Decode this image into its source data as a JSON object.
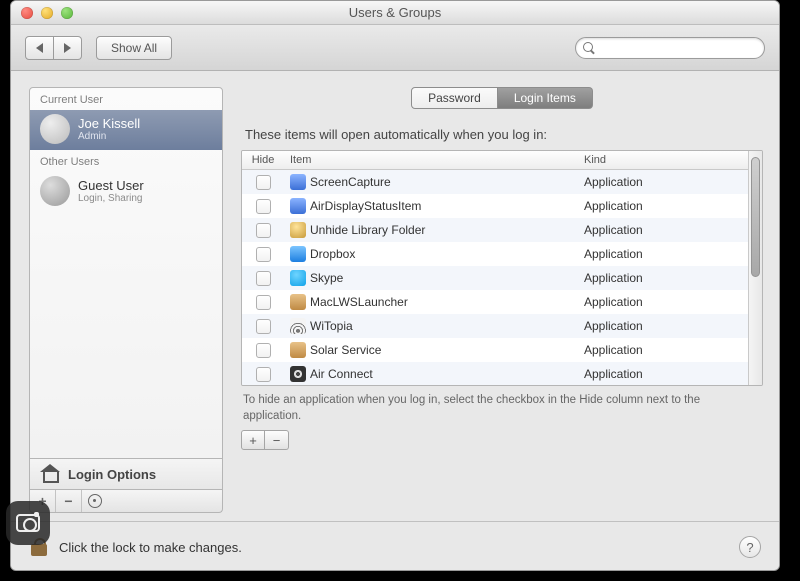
{
  "window": {
    "title": "Users & Groups"
  },
  "toolbar": {
    "show_all": "Show All",
    "search_placeholder": ""
  },
  "sidebar": {
    "current_header": "Current User",
    "other_header": "Other Users",
    "current": {
      "name": "Joe Kissell",
      "role": "Admin"
    },
    "others": [
      {
        "name": "Guest User",
        "role": "Login, Sharing"
      }
    ],
    "login_options": "Login Options"
  },
  "tabs": {
    "password": "Password",
    "login_items": "Login Items"
  },
  "main": {
    "intro": "These items will open automatically when you log in:",
    "columns": {
      "hide": "Hide",
      "item": "Item",
      "kind": "Kind"
    },
    "items": [
      {
        "name": "ScreenCapture",
        "kind": "Application",
        "icon": "ic-blue"
      },
      {
        "name": "AirDisplayStatusItem",
        "kind": "Application",
        "icon": "ic-blue"
      },
      {
        "name": "Unhide Library Folder",
        "kind": "Application",
        "icon": "ic-gold"
      },
      {
        "name": "Dropbox",
        "kind": "Application",
        "icon": "ic-drop"
      },
      {
        "name": "Skype",
        "kind": "Application",
        "icon": "ic-skype"
      },
      {
        "name": "MacLWSLauncher",
        "kind": "Application",
        "icon": "ic-brush"
      },
      {
        "name": "WiTopia",
        "kind": "Application",
        "icon": "ic-wifi"
      },
      {
        "name": "Solar Service",
        "kind": "Application",
        "icon": "ic-brush"
      },
      {
        "name": "Air Connect",
        "kind": "Application",
        "icon": "ic-fan"
      }
    ],
    "hint": "To hide an application when you log in, select the checkbox in the Hide column next to the application."
  },
  "footer": {
    "lock_text": "Click the lock to make changes."
  }
}
